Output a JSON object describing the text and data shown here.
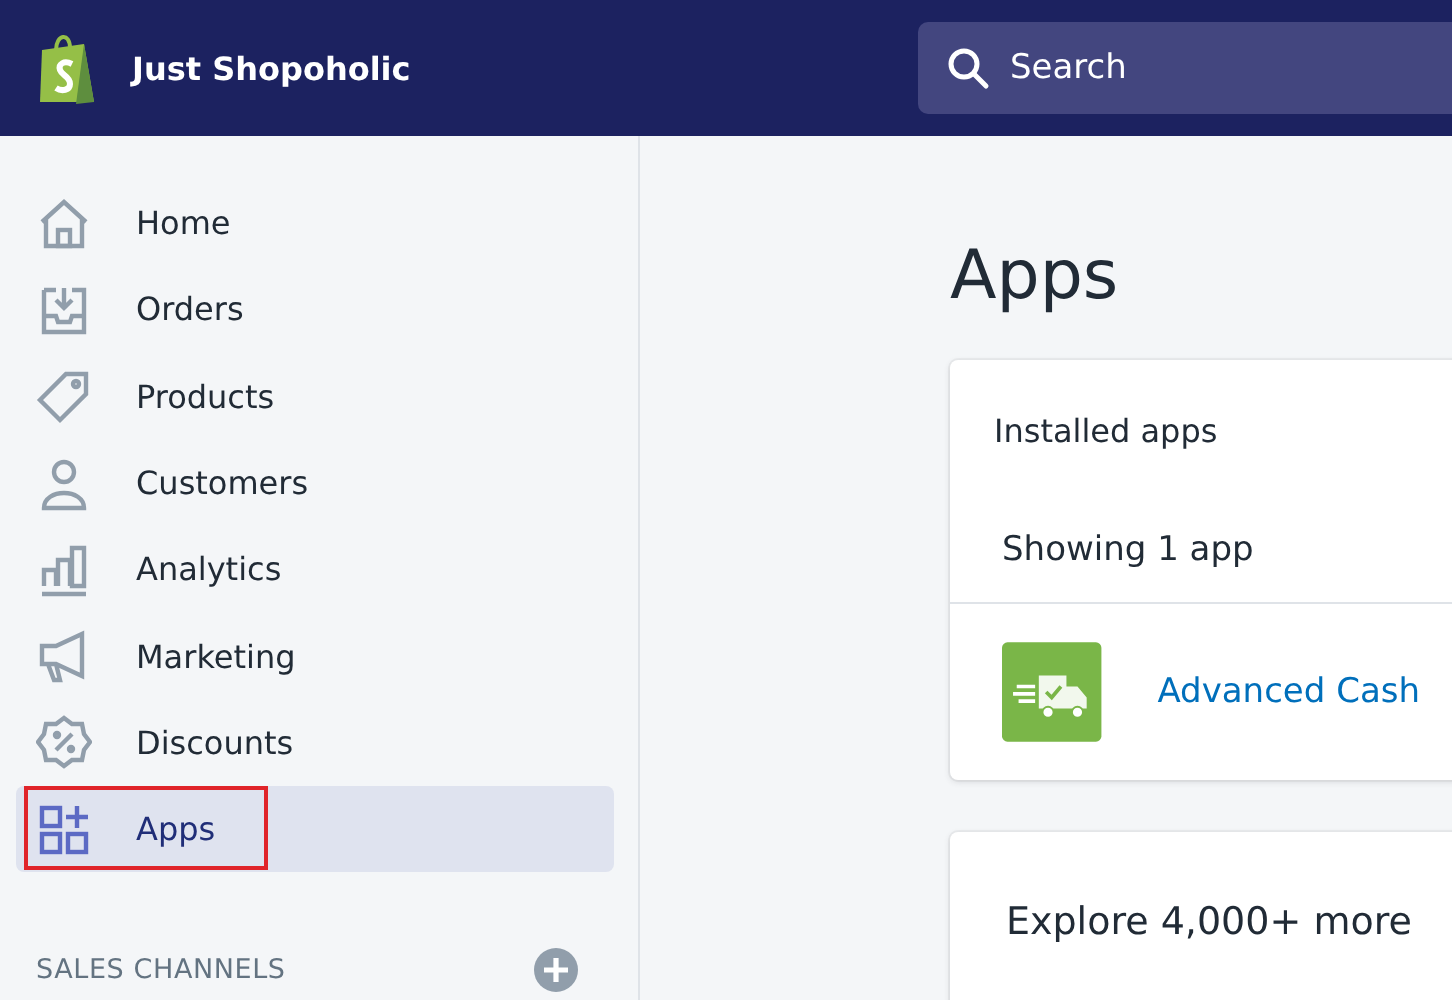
{
  "topbar": {
    "store_name": "Just Shopoholic",
    "search": {
      "placeholder": "Search"
    }
  },
  "sidebar": {
    "items": [
      {
        "label": "Home",
        "kind": "home",
        "selected": false,
        "highlighted": false
      },
      {
        "label": "Orders",
        "kind": "orders",
        "selected": false,
        "highlighted": false
      },
      {
        "label": "Products",
        "kind": "tag",
        "selected": false,
        "highlighted": false
      },
      {
        "label": "Customers",
        "kind": "person",
        "selected": false,
        "highlighted": false
      },
      {
        "label": "Analytics",
        "kind": "chart",
        "selected": false,
        "highlighted": false
      },
      {
        "label": "Marketing",
        "kind": "megaphone",
        "selected": false,
        "highlighted": false
      },
      {
        "label": "Discounts",
        "kind": "discount",
        "selected": false,
        "highlighted": false
      },
      {
        "label": "Apps",
        "kind": "apps",
        "selected": true,
        "highlighted": true
      }
    ],
    "section": {
      "title": "SALES CHANNELS"
    }
  },
  "main": {
    "title": "Apps",
    "installed_card": {
      "title": "Installed apps",
      "count": "Showing 1 app",
      "apps": [
        {
          "name": "Advanced Cash"
        }
      ]
    },
    "explore_card": {
      "title": "Explore 4,000+ more"
    }
  }
}
